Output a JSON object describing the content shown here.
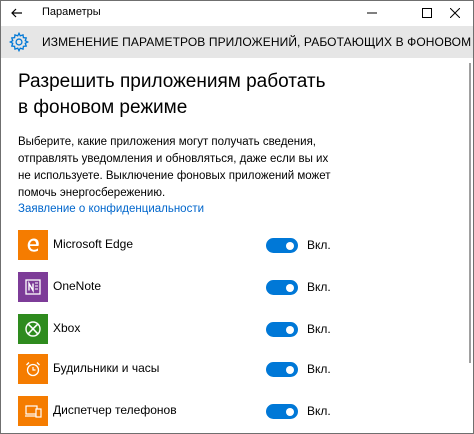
{
  "window": {
    "title": "Параметры",
    "controls": {
      "minimize": "—",
      "maximize": "☐",
      "close": "✕"
    }
  },
  "header": {
    "title": "ИЗМЕНЕНИЕ ПАРАМЕТРОВ ПРИЛОЖЕНИЙ, РАБОТАЮЩИХ В ФОНОВОМ РЕЖИМЕ"
  },
  "main": {
    "heading": "Разрешить приложениям работать в фоновом режиме",
    "description": "Выберите, какие приложения могут получать сведения, отправлять уведомления и обновляться, даже если вы их не используете. Выключение фоновых приложений может помочь энергосбережению.",
    "privacy_link": "Заявление о конфиденциальности"
  },
  "apps": [
    {
      "name": "Microsoft Edge",
      "toggle_label": "Вкл.",
      "enabled": true,
      "icon": "edge-icon",
      "color": "#f57c00"
    },
    {
      "name": "OneNote",
      "toggle_label": "Вкл.",
      "enabled": true,
      "icon": "onenote-icon",
      "color": "#7d3c98"
    },
    {
      "name": "Xbox",
      "toggle_label": "Вкл.",
      "enabled": true,
      "icon": "xbox-icon",
      "color": "#2e8b1e"
    },
    {
      "name": "Будильники и часы",
      "toggle_label": "Вкл.",
      "enabled": true,
      "icon": "alarm-clock-icon",
      "color": "#f57c00"
    },
    {
      "name": "Диспетчер телефонов",
      "toggle_label": "Вкл.",
      "enabled": true,
      "icon": "phone-manager-icon",
      "color": "#f57c00"
    }
  ],
  "colors": {
    "accent": "#0078d7",
    "link": "#0066cc",
    "header_bg": "#e6e6e6"
  }
}
